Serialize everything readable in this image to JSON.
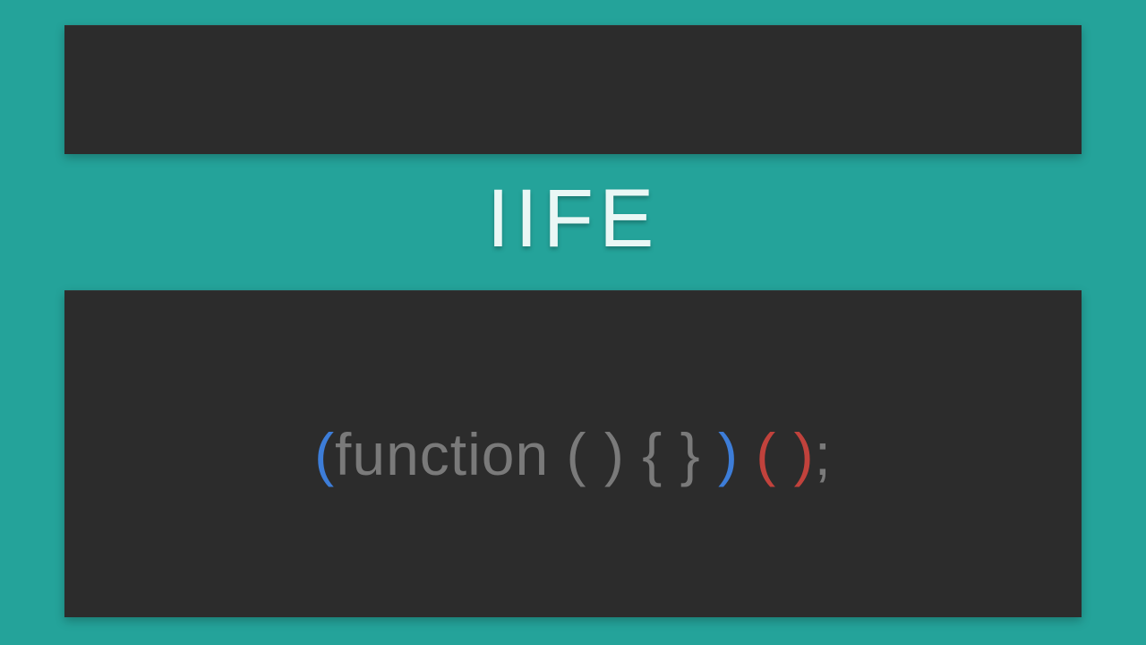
{
  "title": "IIFE",
  "colors": {
    "background": "#24a39a",
    "panel": "#2c2c2c",
    "title": "#eaf7f5",
    "code_default": "#7a7a7a",
    "blue": "#3d7dd8",
    "red": "#c1423c"
  },
  "code": {
    "tokens": [
      {
        "text": "(",
        "color": "blue"
      },
      {
        "text": "function ",
        "color": "code_default"
      },
      {
        "text": "( ) ",
        "color": "code_default"
      },
      {
        "text": "{ } ",
        "color": "code_default"
      },
      {
        "text": ") ",
        "color": "blue"
      },
      {
        "text": "( )",
        "color": "red"
      },
      {
        "text": ";",
        "color": "code_default"
      }
    ]
  }
}
